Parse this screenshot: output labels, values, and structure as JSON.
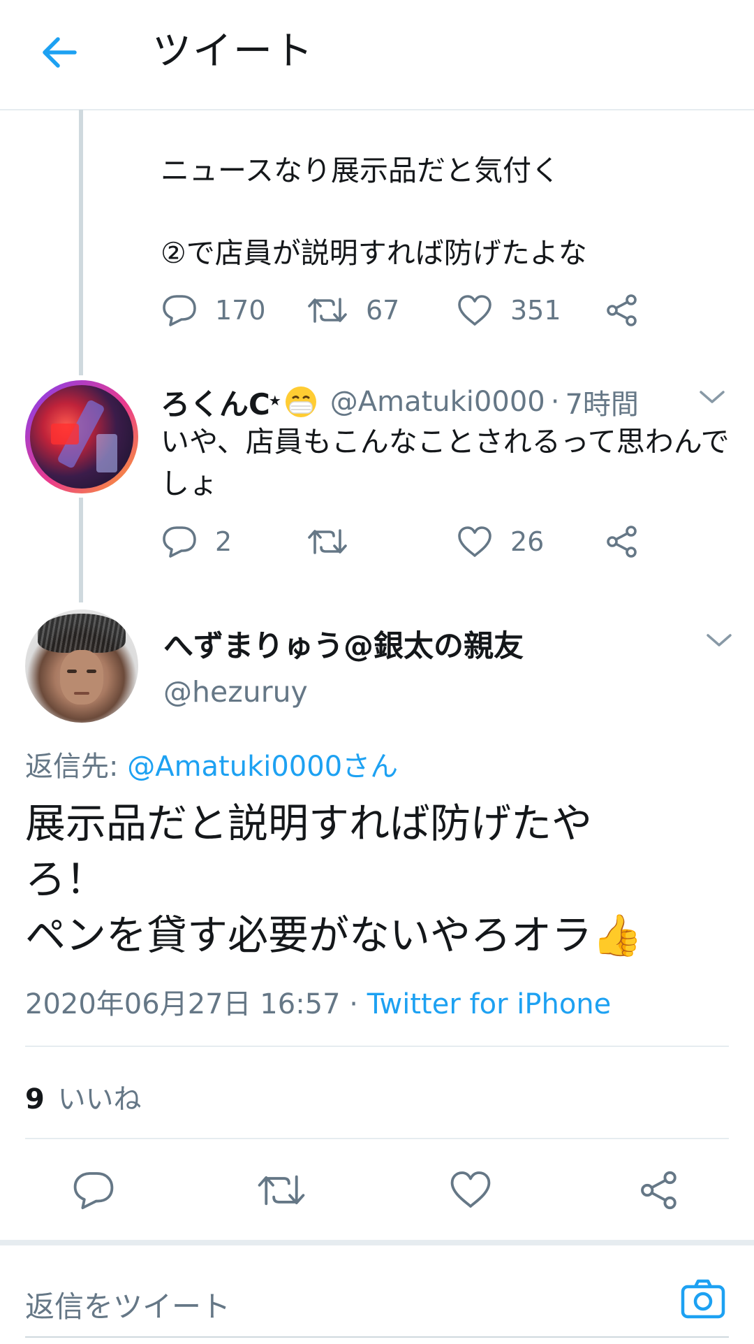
{
  "header": {
    "title": "ツイート"
  },
  "parent_tweet": {
    "text_line1": "ニュースなり展示品だと気付く",
    "text_line2": "②で店員が説明すれば防げたよな",
    "reply_count": "170",
    "retweet_count": "67",
    "like_count": "351"
  },
  "middle_tweet": {
    "display_name": "ろくんC",
    "handle": "@Amatuki0000",
    "separator": "·",
    "time": "7時間",
    "text": "いや、店員もこんなことされるって思わんでしょ",
    "reply_count": "2",
    "retweet_count": "",
    "like_count": "26"
  },
  "main_tweet": {
    "display_name": "へずまりゅう@銀太の親友",
    "handle": "@hezuruy",
    "reply_to_label": "返信先: ",
    "reply_to_user": "@Amatuki0000さん",
    "text_line1": "展示品だと説明すれば防げたや",
    "text_line2": "ろ！",
    "text_line3": "ペンを貸す必要がないやろオラ",
    "emoji": "👍",
    "timestamp": "2020年06月27日 16:57 · ",
    "source": "Twitter for iPhone",
    "likes_count": "9",
    "likes_label": "いいね"
  },
  "composer": {
    "placeholder": "返信をツイート"
  },
  "colors": {
    "accent": "#1da1f2",
    "text": "#14171a",
    "secondary": "#657786",
    "divider": "#e6ecf0"
  }
}
